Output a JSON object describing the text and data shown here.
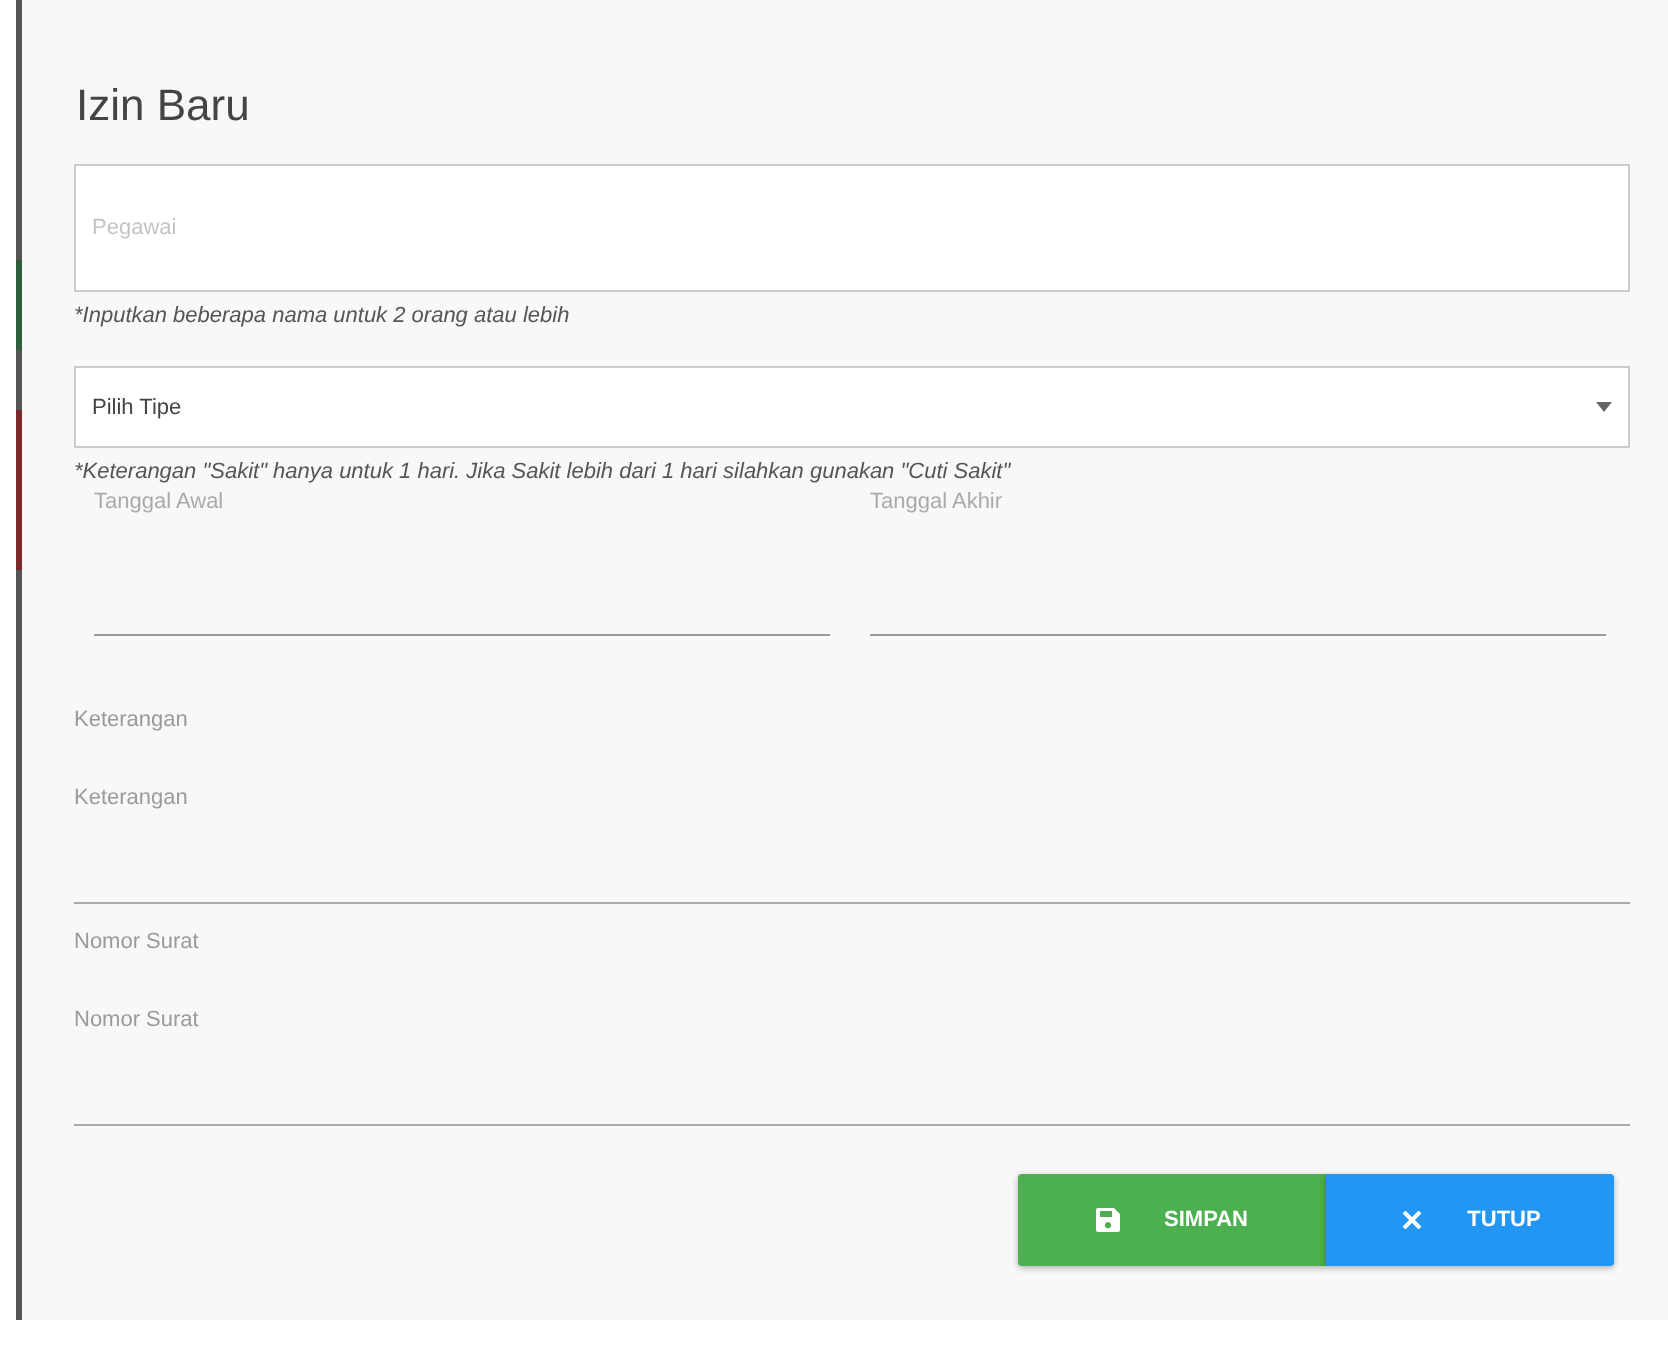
{
  "dialog": {
    "title": "Izin Baru"
  },
  "employee_field": {
    "placeholder": "Pegawai",
    "hint": "*Inputkan beberapa nama untuk 2 orang atau lebih"
  },
  "type_select": {
    "value": "Pilih Tipe",
    "hint": "*Keterangan \"Sakit\" hanya untuk 1 hari. Jika Sakit lebih dari 1 hari silahkan gunakan \"Cuti Sakit\""
  },
  "date_fields": [
    {
      "label": "Tanggal Awal"
    },
    {
      "label": "Tanggal Akhir"
    }
  ],
  "text_fields": [
    {
      "label": "Keterangan",
      "placeholder": "Keterangan"
    },
    {
      "label": "Nomor Surat",
      "placeholder": "Nomor Surat"
    }
  ],
  "buttons": [
    {
      "kind": "save",
      "label": "SIMPAN"
    },
    {
      "kind": "close",
      "label": "TUTUP"
    }
  ]
}
